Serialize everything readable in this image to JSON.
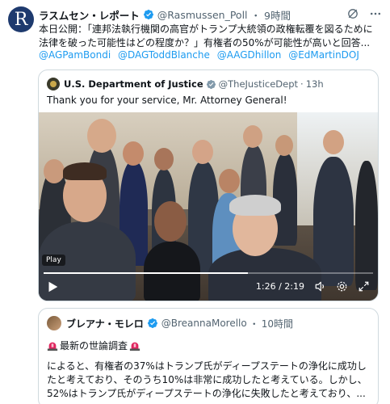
{
  "tweet": {
    "author_name": "ラスムセン・レポート",
    "handle": "@Rasmussen_Poll",
    "separator": "・",
    "time": "9時間",
    "avatar_letter": "R",
    "text_line1": "本日公開：「連邦法執行機関の高官がトランプ大統領の政権転覆を図るために",
    "text_line2": "法律を破った可能性はどの程度か？」有権者の50%が可能性が高いと回答...",
    "mentions": [
      "@AGPamBondi",
      "@DAGToddBlanche",
      "@AAGDhillon",
      "@EdMartinDOJ"
    ]
  },
  "quote1": {
    "author_name": "U.S. Department of Justice",
    "handle": "@TheJusticeDept",
    "separator": "·",
    "time": "13h",
    "text": "Thank you for your service, Mr. Attorney General!",
    "video": {
      "play_label": "Play",
      "time_display": "1:26 / 2:19",
      "progress_fraction": 0.62
    }
  },
  "quote2": {
    "author_name": "ブレアナ・モレロ",
    "handle": "@BreannaMorello",
    "separator": "・",
    "time": "10時間",
    "headline": "最新の世論調査",
    "body_line1": "によると、有権者の37%はトランプ氏がディープステートの浄化に成功し",
    "body_line2": "たと考えており、そのうち10%は非常に成功したと考えている。しかし、",
    "body_line3": "52%はトランプ氏がディープステートの浄化に失敗したと考えており、..."
  },
  "colors": {
    "link": "#1d9bf0",
    "muted": "#536471",
    "verified_blue": "#1d9bf0",
    "gov_gray": "#829aab"
  }
}
